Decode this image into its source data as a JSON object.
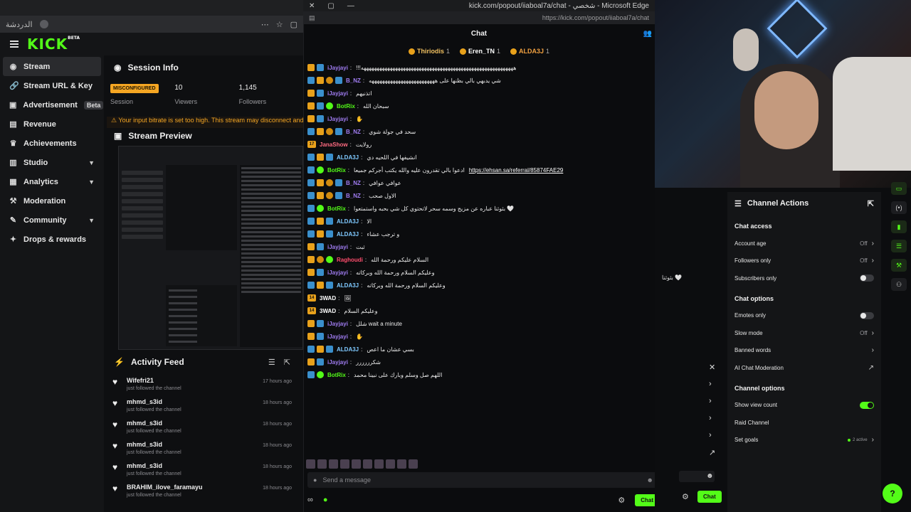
{
  "browser": {
    "url_text": "الدردشة",
    "popout_title": "kick.com/popout/iiaboal7a/chat - شخصي - Microsoft Edge",
    "popout_url": "https://kick.com/popout/iiaboal7a/chat"
  },
  "header": {
    "logo": "KICK",
    "logo_badge": "BETA"
  },
  "sidebar": {
    "items": [
      {
        "label": "Stream",
        "icon": "broadcast-icon"
      },
      {
        "label": "Stream URL & Key",
        "icon": "link-icon"
      },
      {
        "label": "Advertisement",
        "badge": "Beta",
        "icon": "ad-icon"
      },
      {
        "label": "Revenue",
        "icon": "revenue-icon"
      },
      {
        "label": "Achievements",
        "icon": "trophy-icon"
      },
      {
        "label": "Studio",
        "icon": "studio-icon"
      },
      {
        "label": "Analytics",
        "icon": "chart-icon"
      },
      {
        "label": "Moderation",
        "icon": "hammer-icon"
      },
      {
        "label": "Community",
        "icon": "users-icon"
      },
      {
        "label": "Drops & rewards",
        "icon": "gift-icon"
      }
    ]
  },
  "session": {
    "title": "Session Info",
    "status": "MISCONFIGURED",
    "session_label": "Session",
    "viewers_value": "10",
    "viewers_label": "Viewers",
    "followers_value": "1,145",
    "followers_label": "Followers",
    "warning": "Your input bitrate is set too high. This stream may disconnect and wi"
  },
  "preview": {
    "title": "Stream Preview"
  },
  "activity": {
    "title": "Activity Feed",
    "items": [
      {
        "name": "Wifefri21",
        "action": "just followed the channel",
        "time": "17 hours ago"
      },
      {
        "name": "mhmd_s3id",
        "action": "just followed the channel",
        "time": "18 hours ago"
      },
      {
        "name": "mhmd_s3id",
        "action": "just followed the channel",
        "time": "18 hours ago"
      },
      {
        "name": "mhmd_s3id",
        "action": "just followed the channel",
        "time": "18 hours ago"
      },
      {
        "name": "mhmd_s3id",
        "action": "just followed the channel",
        "time": "18 hours ago"
      },
      {
        "name": "BRAHIM_ilove_faramayu",
        "action": "just followed the channel",
        "time": "18 hours ago"
      }
    ]
  },
  "chat": {
    "title": "Chat",
    "leaders": [
      {
        "name": "Thiriodis",
        "count": "1"
      },
      {
        "name": "Eren_TN",
        "count": "1"
      },
      {
        "name": "ALDA3J",
        "count": "1"
      }
    ],
    "messages": [
      {
        "user": "iJayjayi",
        "color": "#a07cf2",
        "badges": [
          "crown",
          "blue"
        ],
        "text": "!!!ههههههههههههههههههههههههههههههههههههههههههههههههههههههههههه"
      },
      {
        "user": "B_NZ",
        "color": "#a07cf2",
        "badges": [
          "blue",
          "crown",
          "gold",
          "blue"
        ],
        "text": "شي يدبهي بالي بظنها على هههههههههههههههههههههههههه"
      },
      {
        "user": "iJayjayi",
        "color": "#a07cf2",
        "badges": [
          "crown",
          "blue"
        ],
        "text": "اتذنيهم"
      },
      {
        "user": "BotRix",
        "color": "#53fc18",
        "badges": [
          "crown",
          "blue",
          "bot"
        ],
        "text": "سبحان الله"
      },
      {
        "user": "iJayjayi",
        "color": "#a07cf2",
        "badges": [
          "crown",
          "blue"
        ],
        "text": "✋"
      },
      {
        "user": "B_NZ",
        "color": "#a07cf2",
        "badges": [
          "blue",
          "crown",
          "gold",
          "blue"
        ],
        "text": "سحد في جولة شوي"
      },
      {
        "user": "JanaShow",
        "color": "#ff6b81",
        "badges": [
          "num17"
        ],
        "text": "رولايت"
      },
      {
        "user": "ALDA3J",
        "color": "#7fc9ff",
        "badges": [
          "blue",
          "crown",
          "blue"
        ],
        "text": "انشيفها في اللحيه دي"
      },
      {
        "user": "BotRix",
        "color": "#53fc18",
        "badges": [
          "blue",
          "bot"
        ],
        "text": "ادعوا بالي تقدرون عليه والله يكتب أجركم جميعا",
        "link": "https://ehsan.sa/referral/85874FAE29"
      },
      {
        "user": "B_NZ",
        "color": "#a07cf2",
        "badges": [
          "blue",
          "crown",
          "gold",
          "blue"
        ],
        "text": "عوافي عوافي"
      },
      {
        "user": "B_NZ",
        "color": "#a07cf2",
        "badges": [
          "blue",
          "crown",
          "gold",
          "blue"
        ],
        "text": "الاول صحب"
      },
      {
        "user": "BotRix",
        "color": "#53fc18",
        "badges": [
          "blue",
          "bot"
        ],
        "text": "بثوثنا عباره عن مزيج وسمه سحر لاتحتوي كل شي بحبه واستمتعوا 🤍"
      },
      {
        "user": "ALDA3J",
        "color": "#7fc9ff",
        "badges": [
          "blue",
          "crown",
          "blue"
        ],
        "text": "الا"
      },
      {
        "user": "ALDA3J",
        "color": "#7fc9ff",
        "badges": [
          "blue",
          "crown",
          "blue"
        ],
        "text": "و ترجب عشاء"
      },
      {
        "user": "iJayjayi",
        "color": "#a07cf2",
        "badges": [
          "crown",
          "blue"
        ],
        "text": "ثبت"
      },
      {
        "user": "Raghoudi",
        "color": "#ff4d6d",
        "badges": [
          "crown",
          "gold",
          "bot"
        ],
        "text": "السلام عليكم ورحمة الله"
      },
      {
        "user": "iJayjayi",
        "color": "#a07cf2",
        "badges": [
          "crown",
          "blue"
        ],
        "text": "وعليكم السلام ورحمة الله وبركاته"
      },
      {
        "user": "ALDA3J",
        "color": "#7fc9ff",
        "badges": [
          "blue",
          "crown",
          "blue"
        ],
        "text": "وعليكم السلام ورحمة الله وبركاته"
      },
      {
        "user": "3WAD",
        "color": "#ffffff",
        "badges": [
          "num14"
        ],
        "text": "🖼"
      },
      {
        "user": "3WAD",
        "color": "#ffffff",
        "badges": [
          "num14"
        ],
        "text": "وعليكم السلام"
      },
      {
        "user": "iJayjayi",
        "color": "#a07cf2",
        "badges": [
          "crown",
          "blue"
        ],
        "text": "شلل wait a minute"
      },
      {
        "user": "iJayjayi",
        "color": "#a07cf2",
        "badges": [
          "crown",
          "blue"
        ],
        "text": "✋"
      },
      {
        "user": "ALDA3J",
        "color": "#7fc9ff",
        "badges": [
          "blue",
          "crown",
          "blue"
        ],
        "text": "بسي عشان ما اعص"
      },
      {
        "user": "iJayjayi",
        "color": "#a07cf2",
        "badges": [
          "crown",
          "blue"
        ],
        "text": "شكرررررر"
      },
      {
        "user": "BotRix",
        "color": "#53fc18",
        "badges": [
          "blue",
          "bot"
        ],
        "text": "اللهم صل وسلم وبارك على نبينا محمد"
      }
    ],
    "input_placeholder": "Send a message",
    "send_label": "Chat"
  },
  "actions": {
    "title": "Channel Actions",
    "chat_access": "Chat access",
    "access_rows": [
      {
        "label": "Account age",
        "value": "Off",
        "kind": "chev"
      },
      {
        "label": "Followers only",
        "value": "Off",
        "kind": "chev"
      },
      {
        "label": "Subscribers only",
        "value": "",
        "kind": "toggle",
        "on": false
      }
    ],
    "chat_options": "Chat options",
    "option_rows": [
      {
        "label": "Emotes only",
        "value": "",
        "kind": "toggle",
        "on": false
      },
      {
        "label": "Slow mode",
        "value": "Off",
        "kind": "chev"
      },
      {
        "label": "Banned words",
        "value": "",
        "kind": "chev"
      },
      {
        "label": "AI Chat Moderation",
        "value": "",
        "kind": "ext"
      }
    ],
    "channel_options": "Channel options",
    "channel_rows": [
      {
        "label": "Show view count",
        "value": "",
        "kind": "toggle",
        "on": true
      },
      {
        "label": "Raid Channel",
        "value": "",
        "kind": "none"
      },
      {
        "label": "Set goals",
        "value": "2 active",
        "kind": "goals"
      }
    ]
  },
  "misc": {
    "side_msg": "بثوثنا 🤍",
    "chat_btn2": "Chat",
    "accent": "#53fc18"
  }
}
